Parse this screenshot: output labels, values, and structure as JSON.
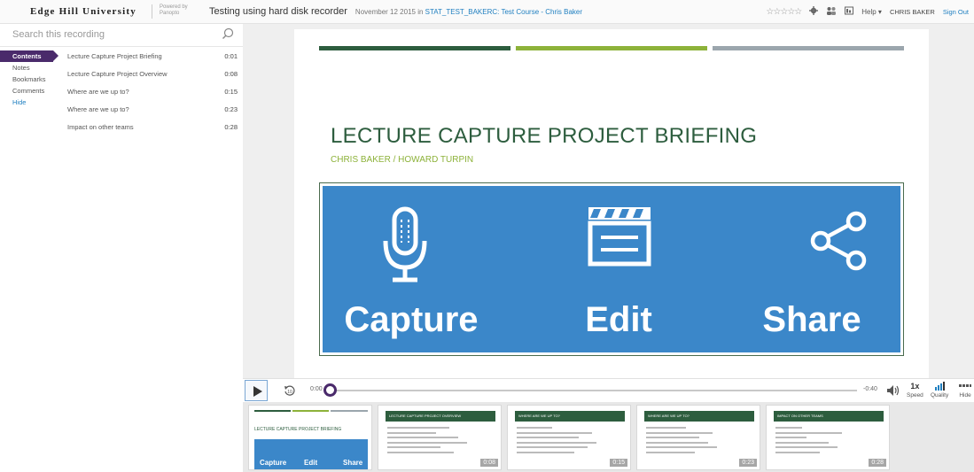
{
  "header": {
    "brand": "Edge Hill University",
    "powered_by": "Powered by Panopto",
    "recording_title": "Testing using hard disk recorder",
    "recording_date": "November 12 2015 in",
    "course": "STAT_TEST_BAKERC: Test Course - Chris Baker",
    "rating": "☆☆☆☆☆",
    "help_label": "Help ▾",
    "user_name": "CHRIS BAKER",
    "signout_label": "Sign Out"
  },
  "sidebar": {
    "search_placeholder": "Search this recording",
    "tabs": [
      {
        "label": "Contents"
      },
      {
        "label": "Notes"
      },
      {
        "label": "Bookmarks"
      },
      {
        "label": "Comments"
      },
      {
        "label": "Hide"
      }
    ],
    "contents": [
      {
        "title": "Lecture Capture Project Briefing",
        "time": "0:01"
      },
      {
        "title": "Lecture Capture Project Overview",
        "time": "0:08"
      },
      {
        "title": "Where are we up to?",
        "time": "0:15"
      },
      {
        "title": "Where are we up to?",
        "time": "0:23"
      },
      {
        "title": "Impact on other teams",
        "time": "0:28"
      }
    ]
  },
  "slide": {
    "title": "LECTURE CAPTURE PROJECT BRIEFING",
    "subtitle": "CHRIS BAKER / HOWARD TURPIN",
    "bar_colors": [
      "#2d5d3e",
      "#8db23a",
      "#9ba6ad"
    ],
    "banner_items": [
      {
        "label": "Capture",
        "icon": "microphone-icon"
      },
      {
        "label": "Edit",
        "icon": "clapperboard-icon"
      },
      {
        "label": "Share",
        "icon": "share-icon"
      }
    ]
  },
  "player": {
    "current_time": "0:00",
    "remaining_time": "-0:40",
    "progress": 0,
    "speed_value": "1x",
    "speed_label": "Speed",
    "quality_label": "Quality",
    "hide_label": "Hide"
  },
  "thumbnails": [
    {
      "time": "",
      "title": "LECTURE CAPTURE PROJECT BRIEFING",
      "labels": [
        "Capture",
        "Edit",
        "Share"
      ]
    },
    {
      "time": "0:08",
      "title": "LECTURE CAPTURE PROJECT OVERVIEW"
    },
    {
      "time": "0:15",
      "title": "WHERE ARE WE UP TO?"
    },
    {
      "time": "0:23",
      "title": "WHERE ARE WE UP TO?"
    },
    {
      "time": "0:28",
      "title": "IMPACT ON OTHER TEAMS"
    }
  ],
  "colors": {
    "accent_purple": "#4a2a6b",
    "banner_blue": "#3b87c9",
    "title_green": "#2d5d3e",
    "sub_green": "#8db23a",
    "link_blue": "#1f7fc0"
  }
}
